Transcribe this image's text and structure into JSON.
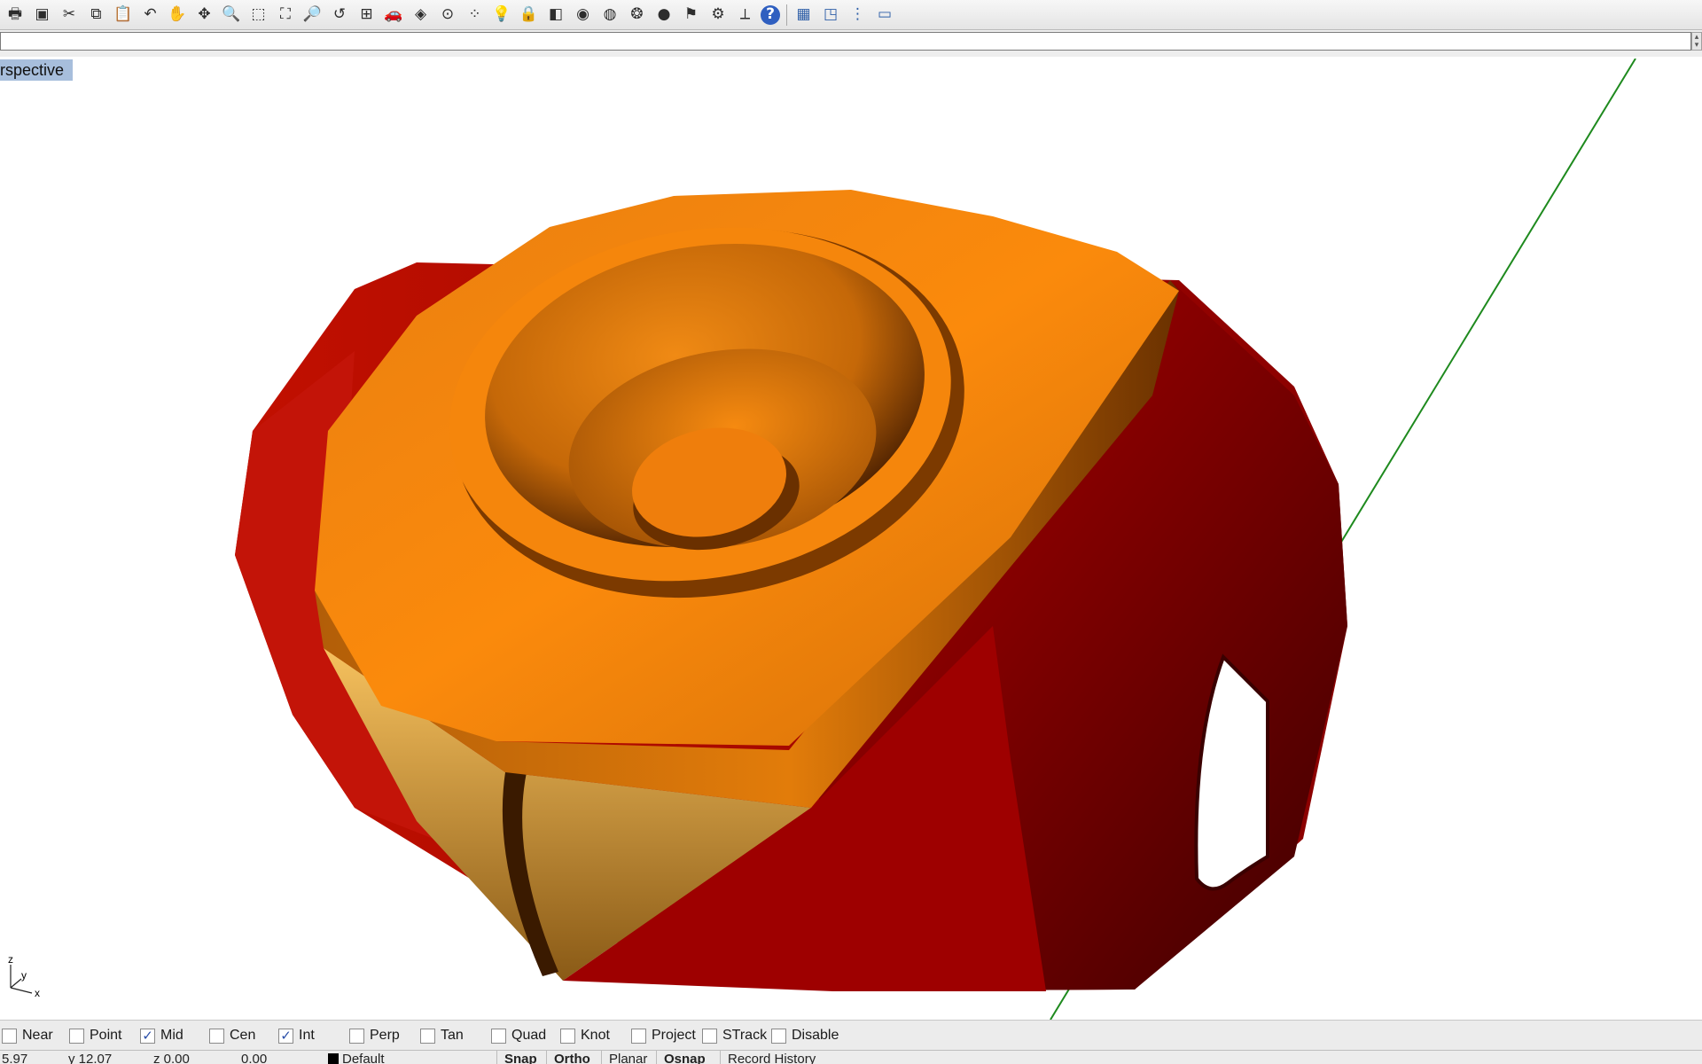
{
  "toolbar": {
    "icons": [
      {
        "name": "print-icon",
        "glyph": "🖶"
      },
      {
        "name": "save-icon",
        "glyph": "▣"
      },
      {
        "name": "cut-icon",
        "glyph": "✂"
      },
      {
        "name": "copy-icon",
        "glyph": "⧉"
      },
      {
        "name": "paste-icon",
        "glyph": "📋"
      },
      {
        "name": "undo-icon",
        "glyph": "↶"
      },
      {
        "name": "pan-hand-icon",
        "glyph": "✋"
      },
      {
        "name": "rotate-view-icon",
        "glyph": "✥"
      },
      {
        "name": "zoom-icon",
        "glyph": "🔍"
      },
      {
        "name": "zoom-window-icon",
        "glyph": "⬚"
      },
      {
        "name": "zoom-extents-icon",
        "glyph": "⛶"
      },
      {
        "name": "zoom-selected-icon",
        "glyph": "🔎"
      },
      {
        "name": "undo-view-icon",
        "glyph": "↺"
      },
      {
        "name": "four-viewports-icon",
        "glyph": "⊞"
      },
      {
        "name": "car-icon",
        "glyph": "🚗"
      },
      {
        "name": "shaded-icon",
        "glyph": "◈"
      },
      {
        "name": "select-icon",
        "glyph": "⊙"
      },
      {
        "name": "points-icon",
        "glyph": "⁘"
      },
      {
        "name": "light-bulb-icon",
        "glyph": "💡"
      },
      {
        "name": "lock-icon",
        "glyph": "🔒"
      },
      {
        "name": "layer-icon",
        "glyph": "◧"
      },
      {
        "name": "color-wheel-icon",
        "glyph": "◉"
      },
      {
        "name": "sphere-grid-icon",
        "glyph": "◍"
      },
      {
        "name": "gear-sphere-icon",
        "glyph": "❂"
      },
      {
        "name": "render-sphere-icon",
        "glyph": "●"
      },
      {
        "name": "flag-icon",
        "glyph": "⚑"
      },
      {
        "name": "options-gear-icon",
        "glyph": "⚙"
      },
      {
        "name": "dimension-icon",
        "glyph": "⟂"
      },
      {
        "name": "help-icon",
        "glyph": "?"
      }
    ],
    "right_icons": [
      {
        "name": "cube-view-icon",
        "glyph": "▦"
      },
      {
        "name": "viewport-layout-icon",
        "glyph": "◳"
      },
      {
        "name": "vertical-grip-icon",
        "glyph": "⋮"
      },
      {
        "name": "window-icon",
        "glyph": "▭"
      }
    ]
  },
  "command": {
    "value": "",
    "placeholder": ""
  },
  "viewport": {
    "title": "rspective",
    "axes": {
      "z": "z",
      "y": "y",
      "x": "x"
    }
  },
  "osnap": [
    {
      "label": "Near",
      "checked": false
    },
    {
      "label": "Point",
      "checked": false
    },
    {
      "label": "Mid",
      "checked": true
    },
    {
      "label": "Cen",
      "checked": false
    },
    {
      "label": "Int",
      "checked": true
    },
    {
      "label": "Perp",
      "checked": false
    },
    {
      "label": "Tan",
      "checked": false
    },
    {
      "label": "Quad",
      "checked": false
    },
    {
      "label": "Knot",
      "checked": false
    },
    {
      "label": "Project",
      "checked": false
    },
    {
      "label": "STrack",
      "checked": false
    },
    {
      "label": "Disable",
      "checked": false
    }
  ],
  "status": {
    "x": "5.97",
    "y": "y 12.07",
    "z": "z 0.00",
    "dist": "0.00",
    "layer": "Default",
    "panes": [
      "Snap",
      "Ortho",
      "Planar",
      "Osnap",
      "Record History"
    ]
  },
  "colors": {
    "orange_top": "#f58a0e",
    "red_body": "#b80a00",
    "tan_face": "#f0b654",
    "viewport_title_bg": "#a7bedc",
    "axis_line": "#1e8a1e"
  }
}
